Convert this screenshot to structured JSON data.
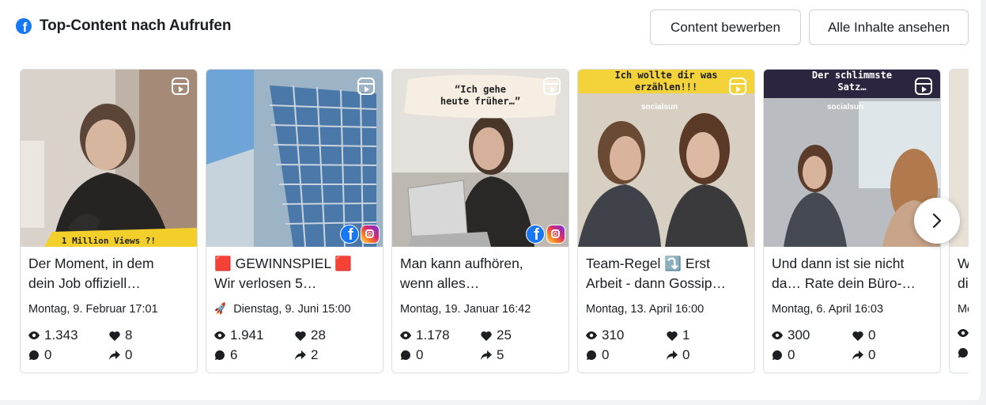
{
  "header": {
    "title": "Top-Content nach Aufrufen",
    "platform_icon": "facebook-icon",
    "promote_label": "Content bewerben",
    "all_content_label": "Alle Inhalte ansehen"
  },
  "cards": [
    {
      "title_line1": "Der Moment, in dem",
      "title_line2": "dein Job offiziell…",
      "date": "Montag, 9. Februar 17:01",
      "overlay_text": "1 Million Views ?!",
      "views": "1.343",
      "likes": "8",
      "comments": "0",
      "shares": "0"
    },
    {
      "title_line1": "🟥 GEWINNSPIEL 🟥",
      "title_line2": "Wir verlosen 5…",
      "date": "Dienstag, 9. Juni 15:00",
      "views": "1.941",
      "likes": "28",
      "comments": "6",
      "shares": "2"
    },
    {
      "title_line1": "Man kann aufhören,",
      "title_line2": "wenn alles…",
      "date": "Montag, 19. Januar 16:42",
      "overlay_text": "“Ich gehe\nheute früher…”",
      "views": "1.178",
      "likes": "25",
      "comments": "0",
      "shares": "5"
    },
    {
      "title_line1": "Team-Regel ⤵️ Erst",
      "title_line2": "Arbeit - dann Gossip…",
      "date": "Montag, 13. April 16:00",
      "overlay_text": "Ich wollte dir was\nerzählen!!!",
      "brand": "socialsun",
      "views": "310",
      "likes": "1",
      "comments": "0",
      "shares": "0"
    },
    {
      "title_line1": "Und dann ist sie nicht",
      "title_line2": "da… Rate dein Büro-…",
      "date": "Montag, 6. April 16:03",
      "overlay_text": "Der schlimmste\nSatz…",
      "brand": "socialsun",
      "views": "300",
      "likes": "0",
      "comments": "0",
      "shares": "0"
    },
    {
      "title_line1": "W",
      "title_line2": "di",
      "date": "Mo",
      "views": "",
      "likes": "",
      "comments": "",
      "shares": ""
    }
  ],
  "icons": {
    "views": "eye-icon",
    "likes": "heart-icon",
    "comments": "comment-icon",
    "shares": "share-icon",
    "reel": "reel-icon",
    "scheduled": "rocket-icon",
    "next": "chevron-right-icon"
  },
  "colors": {
    "facebook_blue": "#1877f2",
    "text": "#1c1e21",
    "border": "#dadde1",
    "overlay_yellow": "#f7d233"
  }
}
